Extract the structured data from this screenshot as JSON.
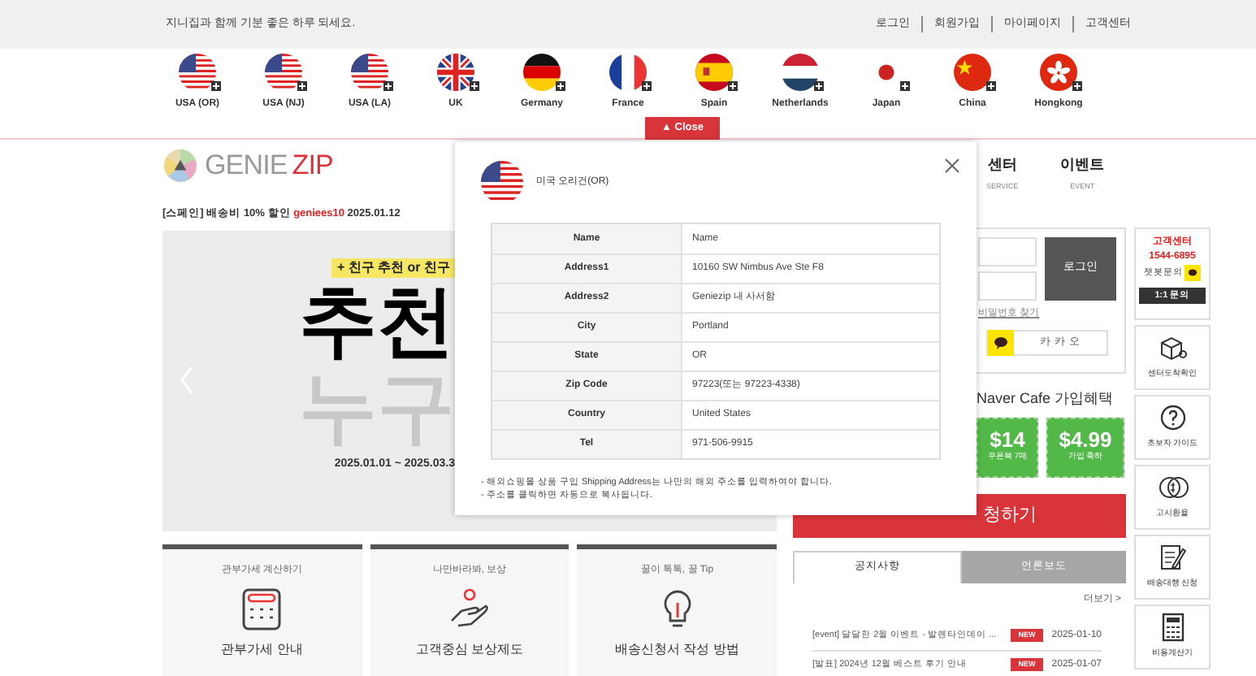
{
  "top_bar": {
    "greeting": "지니집과 함께 기분 좋은 하루 되세요.",
    "links": [
      "로그인",
      "회원가입",
      "마이페이지",
      "고객센터"
    ]
  },
  "flags": [
    {
      "label": "USA (OR)"
    },
    {
      "label": "USA (NJ)"
    },
    {
      "label": "USA (LA)"
    },
    {
      "label": "UK"
    },
    {
      "label": "Germany"
    },
    {
      "label": "France"
    },
    {
      "label": "Spain"
    },
    {
      "label": "Netherlands"
    },
    {
      "label": "Japan"
    },
    {
      "label": "China"
    },
    {
      "label": "Hongkong"
    }
  ],
  "close_button": "▲ Close",
  "logo": {
    "word_1": "GENIE",
    "word_2": "ZIP"
  },
  "promo": {
    "text": "[스페인] 배송비 10% 할인",
    "code": "geniees10",
    "date": "2025.01.12"
  },
  "banner": {
    "tagline": "+ 친구 추천 or 친구",
    "headline": "추천",
    "subhead": "누구",
    "period": "2025.01.01 ~ 2025.03.3"
  },
  "cards": [
    {
      "subtitle": "관부가세 계산하기",
      "title": "관부가세 안내"
    },
    {
      "subtitle": "나만바라봐, 보상",
      "title": "고객중심 보상제도"
    },
    {
      "subtitle": "꿀이 톡톡, 꿀 Tip",
      "title": "배송신청서 작성 방법"
    }
  ],
  "nav": [
    {
      "label": "센터",
      "sub": "SERVICE"
    },
    {
      "label": "이벤트",
      "sub": "EVENT"
    }
  ],
  "login": {
    "button": "로그인",
    "find_password": "비밀번호 찾기",
    "kakao": "카 카 오"
  },
  "naver": {
    "title": "Naver Cafe 가입혜택",
    "coupons": [
      {
        "amount": "$14",
        "caption": "쿠폰북 7매"
      },
      {
        "amount": "$4.99",
        "caption": "가입 축하"
      }
    ]
  },
  "apply_button": "청하기",
  "notice_tabs": [
    {
      "label": "공지사항",
      "selected": true
    },
    {
      "label": "언론보도",
      "selected": false
    }
  ],
  "more_link": "더보기 >",
  "notices": [
    {
      "title": "[event] 달달한 2월 이벤트 - 발렌타인데이 ...",
      "badge": "NEW",
      "date": "2025-01-10"
    },
    {
      "title": "[발표] 2024년 12월 베스트 후기 안내",
      "badge": "NEW",
      "date": "2025-01-07"
    }
  ],
  "sidebar": {
    "support": {
      "title": "고객센터",
      "phone": "1544-6895",
      "chatbot": "챗봇문의",
      "inquiry": "1:1 문의"
    },
    "items": [
      {
        "label": "센터도착확인"
      },
      {
        "label": "초보자 가이드"
      },
      {
        "label": "고시환율"
      },
      {
        "label": "배송대행 신청"
      },
      {
        "label": "비용계산기"
      }
    ]
  },
  "modal": {
    "title": "미국 오리건(OR)",
    "rows": [
      {
        "label": "Name",
        "value": "Name"
      },
      {
        "label": "Address1",
        "value": "10160 SW Nimbus Ave Ste F8"
      },
      {
        "label": "Address2",
        "value": "Geniezip 내 사서함"
      },
      {
        "label": "City",
        "value": "Portland"
      },
      {
        "label": "State",
        "value": "OR"
      },
      {
        "label": "Zip Code",
        "value": "97223(또는 97223-4338)"
      },
      {
        "label": "Country",
        "value": "United States"
      },
      {
        "label": "Tel",
        "value": "971-506-9915"
      }
    ],
    "notes": [
      "- 해외쇼핑몰 상품 구입 Shipping Address는 나만의 해외 주소를 입력하여야 합니다.",
      "- 주소를 클릭하면 자동으로 복사됩니다."
    ]
  }
}
